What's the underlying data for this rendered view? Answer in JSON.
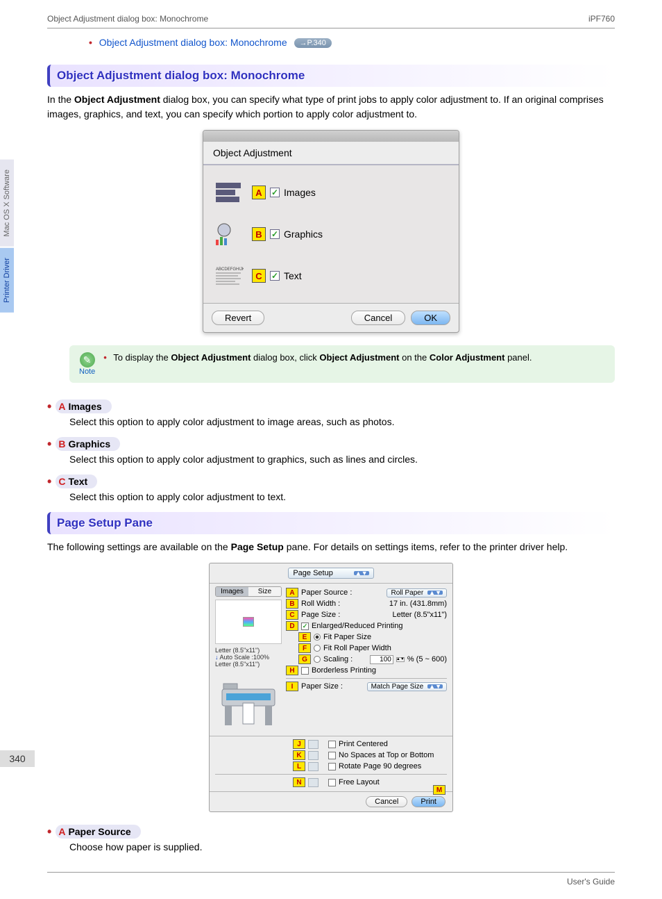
{
  "header": {
    "left": "Object Adjustment dialog box: Monochrome",
    "right": "iPF760"
  },
  "bullet_link": {
    "text": "Object Adjustment dialog box: Monochrome",
    "ref": "→P.340"
  },
  "section1": {
    "title": "Object Adjustment dialog box: Monochrome",
    "intro_pre": "In the ",
    "intro_bold": "Object Adjustment",
    "intro_post": " dialog box, you can specify what type of print jobs to apply color adjustment to. If an original comprises images, graphics, and text, you can specify which portion to apply color adjustment to."
  },
  "obj_dialog": {
    "title": "Object Adjustment",
    "rows": {
      "a": {
        "letter": "A",
        "label": "Images"
      },
      "b": {
        "letter": "B",
        "label": "Graphics"
      },
      "c": {
        "letter": "C",
        "label": "Text"
      }
    },
    "buttons": {
      "revert": "Revert",
      "cancel": "Cancel",
      "ok": "OK"
    }
  },
  "note": {
    "label": "Note",
    "pre": "To display the ",
    "b1": "Object Adjustment",
    "mid1": " dialog box, click ",
    "b2": "Object Adjustment",
    "mid2": " on the ",
    "b3": "Color Adjustment",
    "post": " panel."
  },
  "items1": {
    "a": {
      "letter": "A",
      "title": "Images",
      "desc": "Select this option to apply color adjustment to image areas, such as photos."
    },
    "b": {
      "letter": "B",
      "title": "Graphics",
      "desc": "Select this option to apply color adjustment to graphics, such as lines and circles."
    },
    "c": {
      "letter": "C",
      "title": "Text",
      "desc": "Select this option to apply color adjustment to text."
    }
  },
  "section2": {
    "title": "Page Setup Pane",
    "intro_pre": "The following settings are available on the ",
    "intro_bold": "Page Setup",
    "intro_post": " pane. For details on settings items, refer to the printer driver help."
  },
  "ps": {
    "top_select": "Page Setup",
    "tabs": {
      "images": "Images",
      "size": "Size"
    },
    "meta": {
      "line1": "Letter (8.5\"x11\")",
      "line2": "Auto Scale :100%",
      "line3": "Letter (8.5\"x11\")"
    },
    "a": {
      "letter": "A",
      "label": "Paper Source :",
      "value": "Roll Paper"
    },
    "b": {
      "letter": "B",
      "label": "Roll Width :",
      "value": "17 in. (431.8mm)"
    },
    "c": {
      "letter": "C",
      "label": "Page Size :",
      "value": "Letter (8.5\"x11\")"
    },
    "d": {
      "letter": "D",
      "label": "Enlarged/Reduced Printing"
    },
    "e": {
      "letter": "E",
      "label": "Fit Paper Size"
    },
    "f": {
      "letter": "F",
      "label": "Fit Roll Paper Width"
    },
    "g": {
      "letter": "G",
      "label": "Scaling :",
      "value": "100",
      "range": "% (5 ~ 600)"
    },
    "h": {
      "letter": "H",
      "label": "Borderless Printing"
    },
    "i": {
      "letter": "I",
      "label": "Paper Size :",
      "value": "Match Page Size"
    },
    "j": {
      "letter": "J",
      "label": "Print Centered"
    },
    "k": {
      "letter": "K",
      "label": "No Spaces at Top or Bottom"
    },
    "l": {
      "letter": "L",
      "label": "Rotate Page 90 degrees"
    },
    "n": {
      "letter": "N",
      "label": "Free Layout"
    },
    "m": {
      "letter": "M"
    },
    "buttons": {
      "cancel": "Cancel",
      "print": "Print"
    }
  },
  "items2": {
    "a": {
      "letter": "A",
      "title": "Paper Source",
      "desc": "Choose how paper is supplied."
    }
  },
  "side": {
    "t1": "Mac OS X Software",
    "t2": "Printer Driver"
  },
  "page_number": "340",
  "footer": {
    "right": "User's Guide"
  }
}
